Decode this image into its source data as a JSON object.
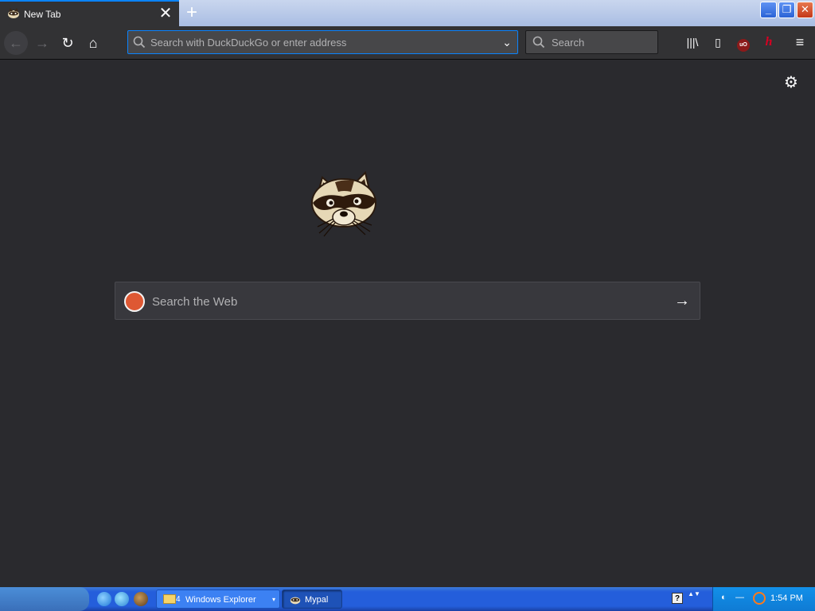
{
  "tab": {
    "title": "New Tab",
    "close_glyph": "✕"
  },
  "newtab_glyph": "+",
  "window_buttons": {
    "minimize": "_",
    "maximize": "❐",
    "close": "✕"
  },
  "nav": {
    "back_glyph": "←",
    "forward_glyph": "→",
    "reload_glyph": "↻",
    "home_glyph": "⌂"
  },
  "urlbar": {
    "placeholder": "Search with DuckDuckGo or enter address",
    "value": "",
    "dropdown_glyph": "⌄"
  },
  "searchbar": {
    "placeholder": "Search",
    "value": ""
  },
  "toolbar": {
    "library_glyph": "|||\\",
    "sidebar_glyph": "▯",
    "ublock_label": "uO",
    "extension_label": "h",
    "menu_glyph": "≡"
  },
  "content": {
    "settings_glyph": "⚙",
    "websearch_placeholder": "Search the Web",
    "websearch_go_glyph": "→"
  },
  "taskbar": {
    "explorer_count": "4",
    "explorer_label": "Windows Explorer",
    "explorer_arrow": "▾",
    "mypal_label": "Mypal",
    "help_glyph": "?",
    "tray_arrows": "▲▼",
    "clock": "1:54 PM"
  },
  "colors": {
    "chrome": "#323234",
    "content_bg": "#2a2a2e",
    "accent": "#0a84ff",
    "field_bg": "#474749",
    "duckduckgo": "#de5833",
    "xp_taskbar": "#245edb"
  },
  "icons": {
    "tab_favicon": "mypal-raccoon-icon",
    "logo": "mypal-raccoon-logo",
    "search": "magnifier-icon",
    "duckduckgo": "duckduckgo-icon"
  }
}
